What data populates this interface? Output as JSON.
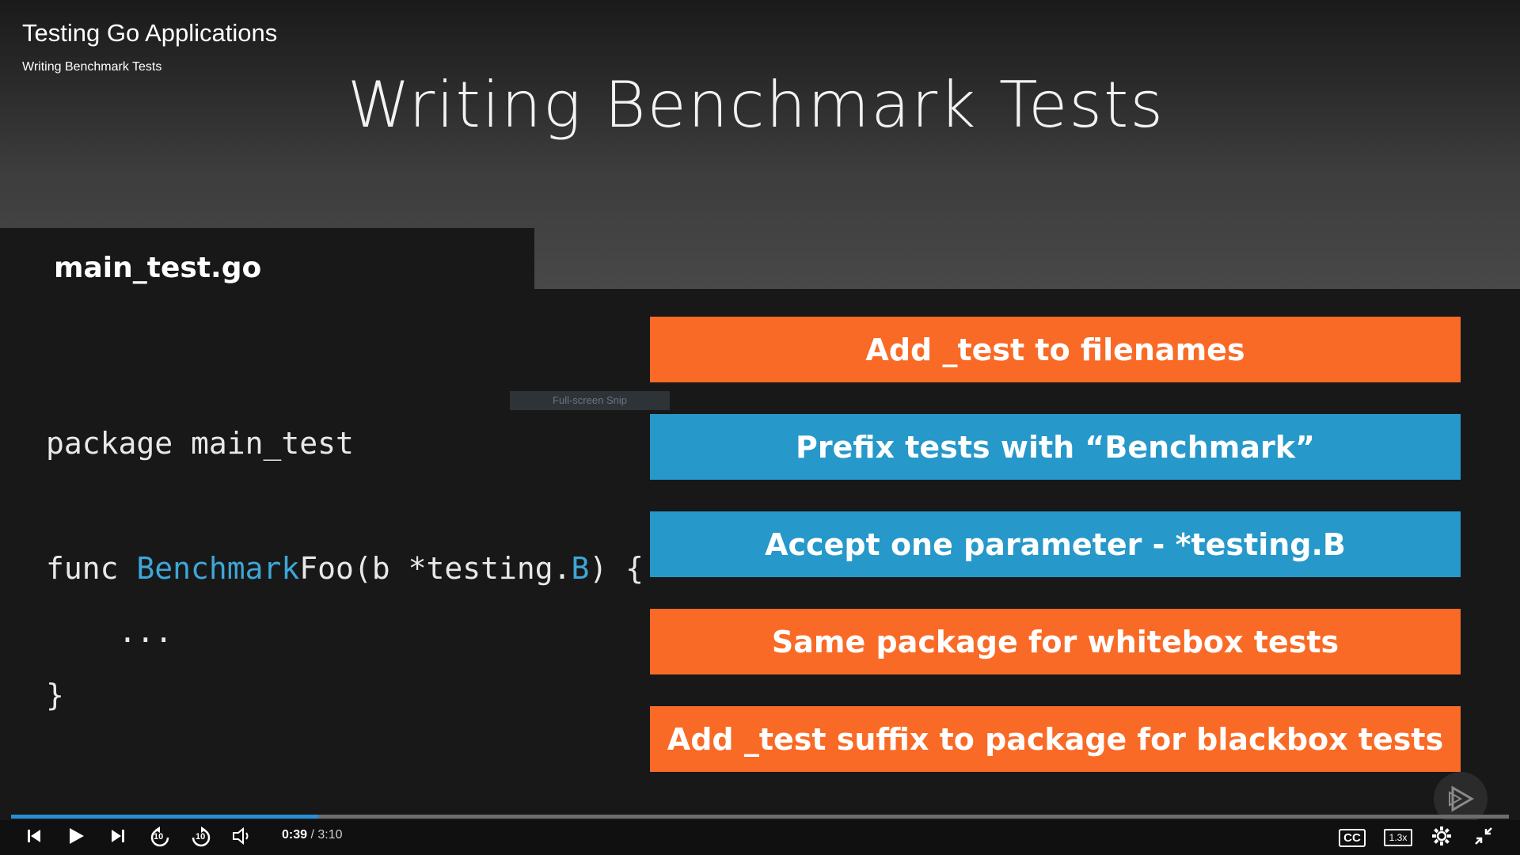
{
  "course": {
    "title": "Testing Go Applications",
    "module": "Writing Benchmark Tests"
  },
  "slide": {
    "title": "Writing Benchmark Tests",
    "file_tab": "main_test.go",
    "code": {
      "line1": "package main_test",
      "func_kw": "func ",
      "func_prefix": "Benchmark",
      "func_rest": "Foo(b *testing.",
      "func_type": "B",
      "func_end": ") {",
      "body": "    ...",
      "close": "}"
    },
    "points": [
      {
        "text": "Add _test to filenames",
        "color": "orange"
      },
      {
        "text": "Prefix tests with “Benchmark”",
        "color": "blue"
      },
      {
        "text": "Accept one parameter - *testing.B",
        "color": "blue"
      },
      {
        "text": "Same package for whitebox tests",
        "color": "orange"
      },
      {
        "text": "Add _test suffix to package for blackbox tests",
        "color": "orange"
      }
    ],
    "colors": {
      "orange": "#f96a26",
      "blue": "#2698c9",
      "code_keyword": "#3ea6d8"
    }
  },
  "snip_tooltip": "Full-screen Snip",
  "player": {
    "progress_fraction": 0.205,
    "current_time": "0:39",
    "separator": " / ",
    "duration": "3:10",
    "speed": "1.3x",
    "cc_label": "CC",
    "rewind_label": "10",
    "forward_label": "10",
    "icons": [
      "skip-back-icon",
      "play-icon",
      "skip-forward-icon",
      "rewind-10-icon",
      "forward-10-icon",
      "volume-icon",
      "cc-icon",
      "speed-icon",
      "gear-icon",
      "exit-fullscreen-icon",
      "pluralsight-logo-icon"
    ]
  }
}
